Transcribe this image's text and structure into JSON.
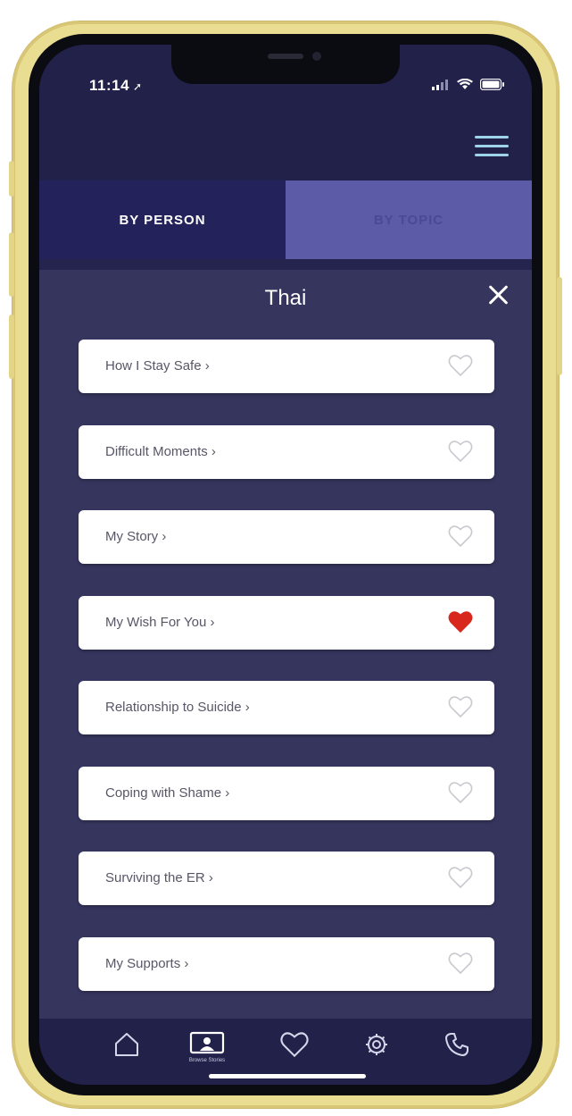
{
  "status_bar": {
    "time": "11:14",
    "location_arrow": "location-arrow-icon",
    "icons": [
      "signal-icon",
      "wifi-icon",
      "battery-icon"
    ]
  },
  "header": {
    "menu_icon": "hamburger-menu-icon"
  },
  "tabs": [
    {
      "label": "BY PERSON",
      "active": true
    },
    {
      "label": "BY TOPIC",
      "active": false
    }
  ],
  "panel": {
    "title": "Thai",
    "close_icon": "close-icon",
    "items": [
      {
        "label": "How I Stay Safe ›",
        "favorite": false
      },
      {
        "label": "Difficult Moments ›",
        "favorite": false
      },
      {
        "label": "My Story ›",
        "favorite": false
      },
      {
        "label": "My Wish For You ›",
        "favorite": true
      },
      {
        "label": "Relationship to Suicide ›",
        "favorite": false
      },
      {
        "label": "Coping with Shame ›",
        "favorite": false
      },
      {
        "label": "Surviving the ER ›",
        "favorite": false
      },
      {
        "label": "My Supports ›",
        "favorite": false
      }
    ]
  },
  "bottom_nav": [
    {
      "icon": "home-icon",
      "caption": ""
    },
    {
      "icon": "browse-stories-icon",
      "caption": "Browse Stories"
    },
    {
      "icon": "heart-icon",
      "caption": ""
    },
    {
      "icon": "settings-icon",
      "caption": ""
    },
    {
      "icon": "phone-icon",
      "caption": ""
    }
  ],
  "colors": {
    "frame_gold": "#e9dd92",
    "background_navy": "#22214a",
    "panel_purple": "#36355e",
    "active_tab": "#23225a",
    "inactive_tab": "#5b5ba8",
    "favorite_red": "#d8281e",
    "heart_outline": "#c9c9cf",
    "menu_accent": "#9ed4ea"
  }
}
